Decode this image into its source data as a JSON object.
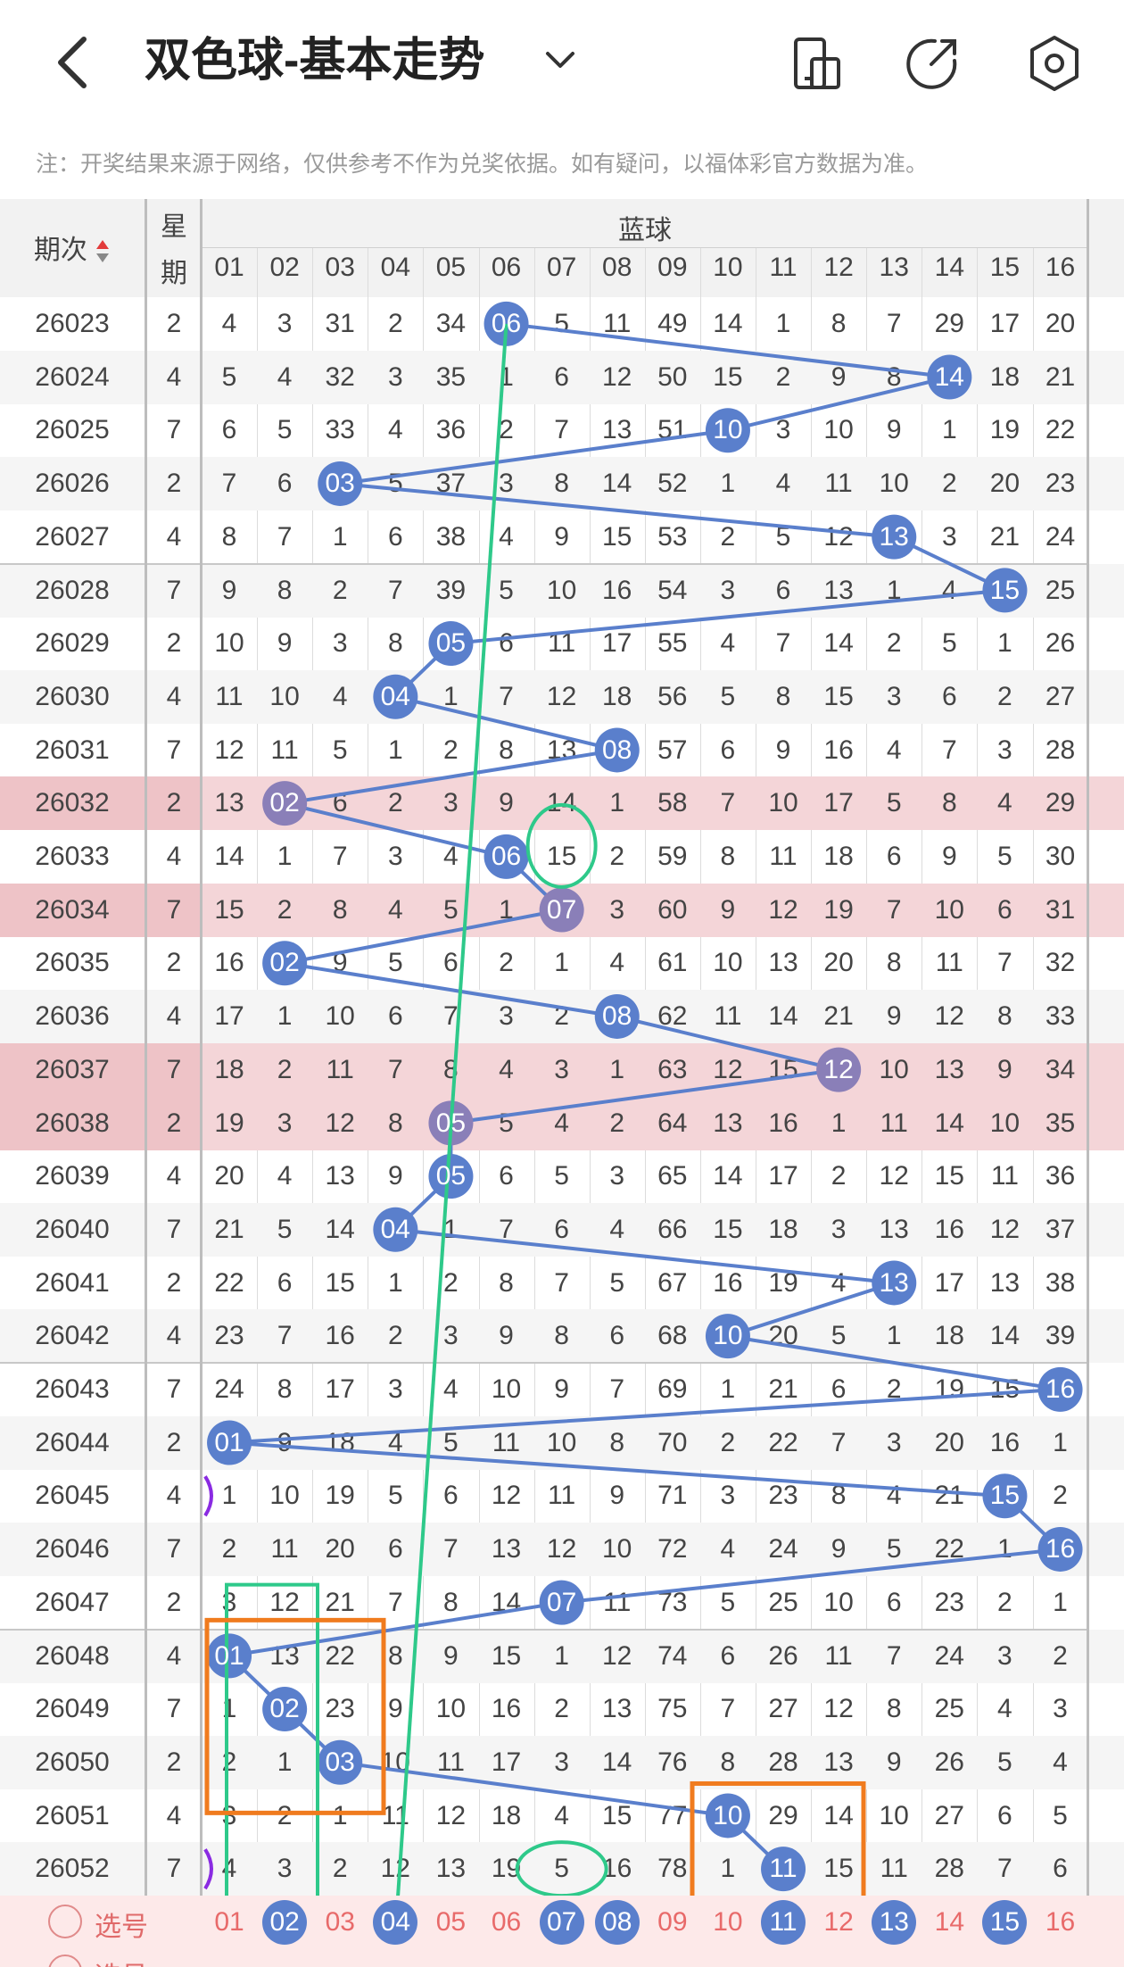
{
  "header": {
    "title": "双色球-基本走势",
    "note": "注：开奖结果来源于网络，仅供参考不作为兑奖依据。如有疑问，以福体彩官方数据为准。"
  },
  "table": {
    "issue_header": "期次",
    "week_header": [
      "星",
      "期"
    ],
    "blue_header": "蓝球",
    "columns": [
      "01",
      "02",
      "03",
      "04",
      "05",
      "06",
      "07",
      "08",
      "09",
      "10",
      "11",
      "12",
      "13",
      "14",
      "15",
      "16"
    ],
    "rows": [
      {
        "issue": "26023",
        "week": "2",
        "cells": [
          "4",
          "3",
          "31",
          "2",
          "34",
          "06",
          "5",
          "11",
          "49",
          "14",
          "1",
          "8",
          "7",
          "29",
          "17",
          "20"
        ],
        "hit": 5
      },
      {
        "issue": "26024",
        "week": "4",
        "cells": [
          "5",
          "4",
          "32",
          "3",
          "35",
          "1",
          "6",
          "12",
          "50",
          "15",
          "2",
          "9",
          "8",
          "14",
          "18",
          "21"
        ],
        "hit": 13
      },
      {
        "issue": "26025",
        "week": "7",
        "cells": [
          "6",
          "5",
          "33",
          "4",
          "36",
          "2",
          "7",
          "13",
          "51",
          "10",
          "3",
          "10",
          "9",
          "1",
          "19",
          "22"
        ],
        "hit": 9
      },
      {
        "issue": "26026",
        "week": "2",
        "cells": [
          "7",
          "6",
          "03",
          "5",
          "37",
          "3",
          "8",
          "14",
          "52",
          "1",
          "4",
          "11",
          "10",
          "2",
          "20",
          "23"
        ],
        "hit": 2
      },
      {
        "issue": "26027",
        "week": "4",
        "cells": [
          "8",
          "7",
          "1",
          "6",
          "38",
          "4",
          "9",
          "15",
          "53",
          "2",
          "5",
          "12",
          "13",
          "3",
          "21",
          "24"
        ],
        "hit": 12
      },
      {
        "issue": "26028",
        "week": "7",
        "cells": [
          "9",
          "8",
          "2",
          "7",
          "39",
          "5",
          "10",
          "16",
          "54",
          "3",
          "6",
          "13",
          "1",
          "4",
          "15",
          "25"
        ],
        "hit": 14
      },
      {
        "issue": "26029",
        "week": "2",
        "cells": [
          "10",
          "9",
          "3",
          "8",
          "05",
          "6",
          "11",
          "17",
          "55",
          "4",
          "7",
          "14",
          "2",
          "5",
          "1",
          "26"
        ],
        "hit": 4
      },
      {
        "issue": "26030",
        "week": "4",
        "cells": [
          "11",
          "10",
          "4",
          "04",
          "1",
          "7",
          "12",
          "18",
          "56",
          "5",
          "8",
          "15",
          "3",
          "6",
          "2",
          "27"
        ],
        "hit": 3
      },
      {
        "issue": "26031",
        "week": "7",
        "cells": [
          "12",
          "11",
          "5",
          "1",
          "2",
          "8",
          "13",
          "08",
          "57",
          "6",
          "9",
          "16",
          "4",
          "7",
          "3",
          "28"
        ],
        "hit": 7
      },
      {
        "issue": "26032",
        "week": "2",
        "cells": [
          "13",
          "02",
          "6",
          "2",
          "3",
          "9",
          "14",
          "1",
          "58",
          "7",
          "10",
          "17",
          "5",
          "8",
          "4",
          "29"
        ],
        "hit": 1,
        "hl": true
      },
      {
        "issue": "26033",
        "week": "4",
        "cells": [
          "14",
          "1",
          "7",
          "3",
          "4",
          "06",
          "15",
          "2",
          "59",
          "8",
          "11",
          "18",
          "6",
          "9",
          "5",
          "30"
        ],
        "hit": 5
      },
      {
        "issue": "26034",
        "week": "7",
        "cells": [
          "15",
          "2",
          "8",
          "4",
          "5",
          "1",
          "07",
          "3",
          "60",
          "9",
          "12",
          "19",
          "7",
          "10",
          "6",
          "31"
        ],
        "hit": 6,
        "hl": true
      },
      {
        "issue": "26035",
        "week": "2",
        "cells": [
          "16",
          "02",
          "9",
          "5",
          "6",
          "2",
          "1",
          "4",
          "61",
          "10",
          "13",
          "20",
          "8",
          "11",
          "7",
          "32"
        ],
        "hit": 1
      },
      {
        "issue": "26036",
        "week": "4",
        "cells": [
          "17",
          "1",
          "10",
          "6",
          "7",
          "3",
          "2",
          "08",
          "62",
          "11",
          "14",
          "21",
          "9",
          "12",
          "8",
          "33"
        ],
        "hit": 7
      },
      {
        "issue": "26037",
        "week": "7",
        "cells": [
          "18",
          "2",
          "11",
          "7",
          "8",
          "4",
          "3",
          "1",
          "63",
          "12",
          "15",
          "12",
          "10",
          "13",
          "9",
          "34"
        ],
        "hit": 11,
        "hl": true
      },
      {
        "issue": "26038",
        "week": "2",
        "cells": [
          "19",
          "3",
          "12",
          "8",
          "05",
          "5",
          "4",
          "2",
          "64",
          "13",
          "16",
          "1",
          "11",
          "14",
          "10",
          "35"
        ],
        "hit": 4,
        "hl": true
      },
      {
        "issue": "26039",
        "week": "4",
        "cells": [
          "20",
          "4",
          "13",
          "9",
          "05",
          "6",
          "5",
          "3",
          "65",
          "14",
          "17",
          "2",
          "12",
          "15",
          "11",
          "36"
        ],
        "hit": 4
      },
      {
        "issue": "26040",
        "week": "7",
        "cells": [
          "21",
          "5",
          "14",
          "04",
          "1",
          "7",
          "6",
          "4",
          "66",
          "15",
          "18",
          "3",
          "13",
          "16",
          "12",
          "37"
        ],
        "hit": 3
      },
      {
        "issue": "26041",
        "week": "2",
        "cells": [
          "22",
          "6",
          "15",
          "1",
          "2",
          "8",
          "7",
          "5",
          "67",
          "16",
          "19",
          "4",
          "13",
          "17",
          "13",
          "38"
        ],
        "hit": 12
      },
      {
        "issue": "26042",
        "week": "4",
        "cells": [
          "23",
          "7",
          "16",
          "2",
          "3",
          "9",
          "8",
          "6",
          "68",
          "10",
          "20",
          "5",
          "1",
          "18",
          "14",
          "39"
        ],
        "hit": 9
      },
      {
        "issue": "26043",
        "week": "7",
        "cells": [
          "24",
          "8",
          "17",
          "3",
          "4",
          "10",
          "9",
          "7",
          "69",
          "1",
          "21",
          "6",
          "2",
          "19",
          "15",
          "16"
        ],
        "hit": 15
      },
      {
        "issue": "26044",
        "week": "2",
        "cells": [
          "01",
          "9",
          "18",
          "4",
          "5",
          "11",
          "10",
          "8",
          "70",
          "2",
          "22",
          "7",
          "3",
          "20",
          "16",
          "1"
        ],
        "hit": 0
      },
      {
        "issue": "26045",
        "week": "4",
        "cells": [
          "1",
          "10",
          "19",
          "5",
          "6",
          "12",
          "11",
          "9",
          "71",
          "3",
          "23",
          "8",
          "4",
          "21",
          "15",
          "2"
        ],
        "hit": 14
      },
      {
        "issue": "26046",
        "week": "7",
        "cells": [
          "2",
          "11",
          "20",
          "6",
          "7",
          "13",
          "12",
          "10",
          "72",
          "4",
          "24",
          "9",
          "5",
          "22",
          "1",
          "16"
        ],
        "hit": 15
      },
      {
        "issue": "26047",
        "week": "2",
        "cells": [
          "3",
          "12",
          "21",
          "7",
          "8",
          "14",
          "07",
          "11",
          "73",
          "5",
          "25",
          "10",
          "6",
          "23",
          "2",
          "1"
        ],
        "hit": 6
      },
      {
        "issue": "26048",
        "week": "4",
        "cells": [
          "01",
          "13",
          "22",
          "8",
          "9",
          "15",
          "1",
          "12",
          "74",
          "6",
          "26",
          "11",
          "7",
          "24",
          "3",
          "2"
        ],
        "hit": 0
      },
      {
        "issue": "26049",
        "week": "7",
        "cells": [
          "1",
          "02",
          "23",
          "9",
          "10",
          "16",
          "2",
          "13",
          "75",
          "7",
          "27",
          "12",
          "8",
          "25",
          "4",
          "3"
        ],
        "hit": 1
      },
      {
        "issue": "26050",
        "week": "2",
        "cells": [
          "2",
          "1",
          "03",
          "10",
          "11",
          "17",
          "3",
          "14",
          "76",
          "8",
          "28",
          "13",
          "9",
          "26",
          "5",
          "4"
        ],
        "hit": 2
      },
      {
        "issue": "26051",
        "week": "4",
        "cells": [
          "3",
          "2",
          "1",
          "11",
          "12",
          "18",
          "4",
          "15",
          "77",
          "10",
          "29",
          "14",
          "10",
          "27",
          "6",
          "5"
        ],
        "hit": 9
      },
      {
        "issue": "26052",
        "week": "7",
        "cells": [
          "4",
          "3",
          "2",
          "12",
          "13",
          "19",
          "5",
          "16",
          "78",
          "1",
          "11",
          "15",
          "11",
          "28",
          "7",
          "6"
        ],
        "hit": 10
      }
    ]
  },
  "footer": {
    "select_label": "选号",
    "select_label_2": "选号",
    "select_balls": [
      "01",
      "02",
      "03",
      "04",
      "05",
      "06",
      "07",
      "08",
      "09",
      "10",
      "11",
      "12",
      "13",
      "14",
      "15",
      "16"
    ],
    "selected": [
      1,
      3,
      6,
      7,
      10,
      12,
      14
    ]
  },
  "colors": {
    "ball": "#5a7fcc",
    "ball_hl": "#8a7fb8",
    "line": "#5a7fcc",
    "green": "#2ec98a",
    "orange": "#f07b1e",
    "highlight_row": "#f4d5d8",
    "select_red": "#e86a6a"
  }
}
